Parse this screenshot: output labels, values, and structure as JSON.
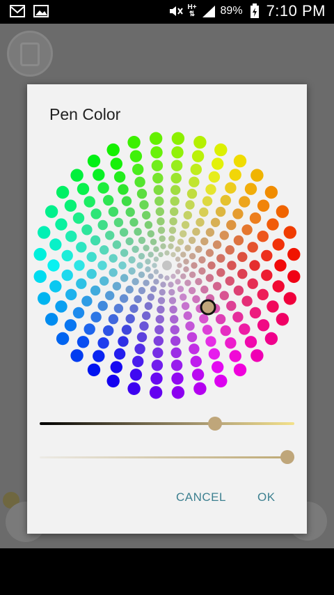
{
  "status_bar": {
    "network_label": "H+",
    "battery": "89%",
    "time": "7:10 PM"
  },
  "dialog": {
    "title": "Pen Color",
    "cancel_label": "CANCEL",
    "ok_label": "OK",
    "selected_color": "#bfa67a",
    "brightness_level": 0.7,
    "opacity_level": 1.0
  },
  "colors": {
    "button_text": "#3d8090",
    "dialog_bg": "#f2f2f2"
  }
}
